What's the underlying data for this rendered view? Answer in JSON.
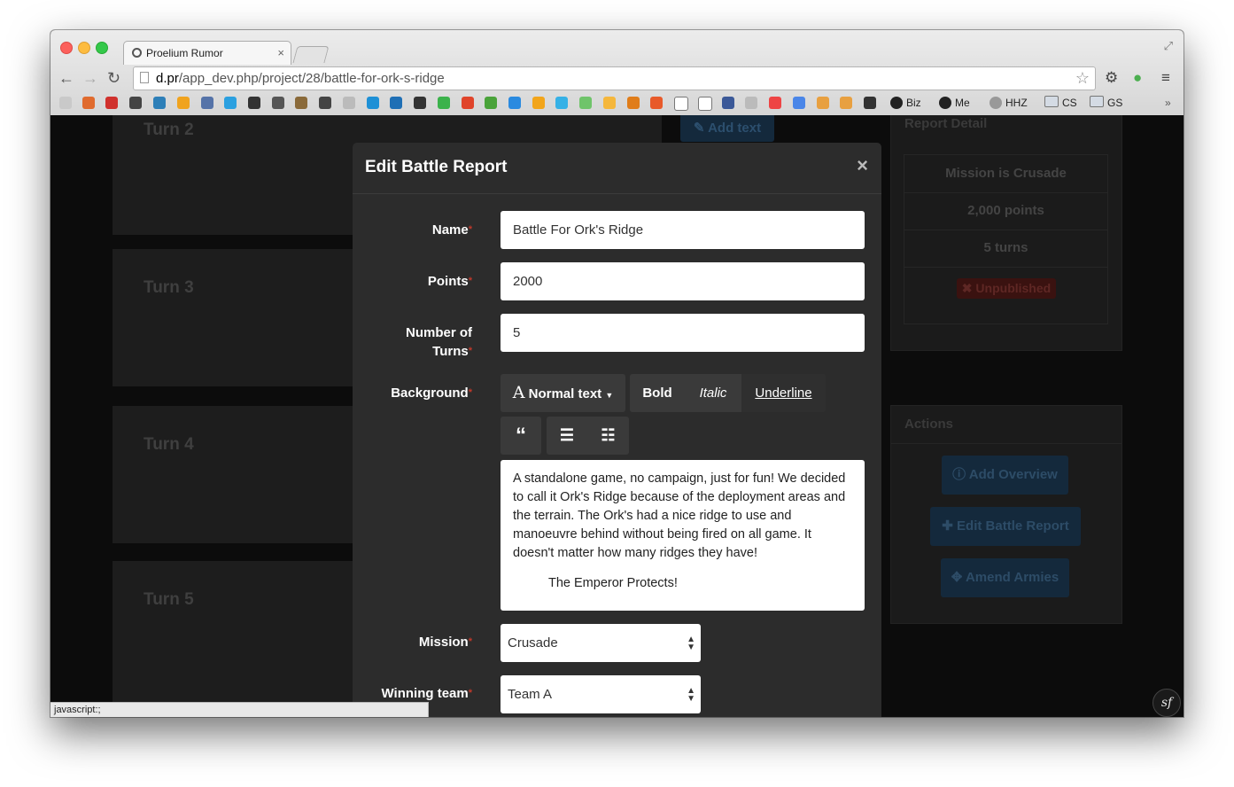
{
  "browser": {
    "tab_title": "Proelium Rumor",
    "tab_close": "×",
    "url_host": "d.pr",
    "url_path": "/app_dev.php/project/28/battle-for-ork-s-ridge",
    "bookmarks": {
      "biz": "Biz",
      "me": "Me",
      "hhz": "HHZ",
      "cs": "CS",
      "gs": "GS",
      "more": "»"
    },
    "status_text": "javascript:;"
  },
  "page": {
    "turns": [
      "Turn 2",
      "Turn 3",
      "Turn 4",
      "Turn 5"
    ],
    "add_text_label": "Add text",
    "report_detail": {
      "heading": "Report Detail",
      "mission": "Mission is Crusade",
      "points": "2,000 points",
      "turns": "5 turns",
      "status": "Unpublished"
    },
    "actions": {
      "heading": "Actions",
      "add_overview": "Add Overview",
      "edit_battle_report": "Edit Battle Report",
      "amend_armies": "Amend Armies"
    }
  },
  "modal": {
    "title": "Edit Battle Report",
    "close": "×",
    "name_label": "Name",
    "name_value": "Battle For Ork's Ridge",
    "points_label": "Points",
    "points_value": "2000",
    "turns_label_line1": "Number of",
    "turns_label_line2": "Turns",
    "turns_value": "5",
    "background_label": "Background",
    "required_marker": "*",
    "toolbar": {
      "style_label": "Normal text",
      "bold": "Bold",
      "italic": "Italic",
      "underline": "Underline"
    },
    "background_text": "A standalone game, no campaign, just for fun! We decided to call it Ork's Ridge because of the deployment areas and the terrain. The Ork's had a nice ridge to use and manoeuvre behind without being fired on all game. It doesn't matter how many ridges they have!",
    "background_quote": "The Emperor Protects!",
    "mission_label": "Mission",
    "mission_value": "Crusade",
    "winning_team_label": "Winning team",
    "winning_team_value": "Team A"
  },
  "colors": {
    "accent_blue": "#14293c",
    "danger": "#c0392b",
    "modal_bg": "#2c2c2c"
  },
  "icons": [
    "back-arrow-icon",
    "forward-arrow-icon",
    "reload-icon",
    "page-icon",
    "star-icon",
    "gear-icon",
    "evernote-icon",
    "menu-icon",
    "pencil-square-icon",
    "times-icon",
    "info-circle-icon",
    "plus-icon",
    "crosshairs-icon",
    "font-icon",
    "caret-down-icon",
    "quote-icon",
    "list-icon",
    "indent-list-icon",
    "symfony-icon"
  ]
}
